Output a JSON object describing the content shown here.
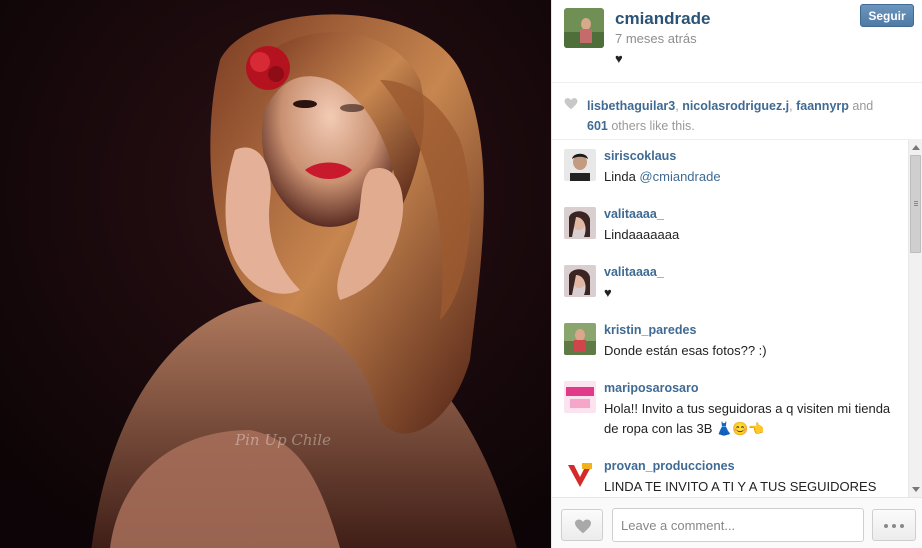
{
  "post": {
    "owner_username": "cmiandrade",
    "time_ago": "7 meses atrás",
    "caption": "♥",
    "follow_label": "Seguir",
    "photo_watermark": "Pin Up Chile"
  },
  "likes": {
    "users": [
      "lisbethaguilar3",
      "nicolasrodriguez.j",
      "faannyrp"
    ],
    "sep1": ", ",
    "sep2": ", ",
    "and_text": " and",
    "count": "601",
    "tail_text": " others like this."
  },
  "comments": [
    {
      "username": "siriscoklaus",
      "text": "Linda ",
      "mention": "@cmiandrade"
    },
    {
      "username": "valitaaaa_",
      "text": "Lindaaaaaaa"
    },
    {
      "username": "valitaaaa_",
      "text": "♥"
    },
    {
      "username": "kristin_paredes",
      "text": "Donde están esas fotos?? :)"
    },
    {
      "username": "mariposarosaro",
      "text": "Hola!! Invito a tus seguidoras a q visiten mi tienda de ropa con las 3B 👗😊👈"
    },
    {
      "username": "provan_producciones",
      "text": "LINDA TE INVITO A TI Y A TUS SEGUIDORES 😉👌A VER NUESTRA NUEVA COLECCIÓN ANIMAL PRINT!!💋💋💋NO,SE LO PIERDAN 💖💖👈"
    }
  ],
  "footer": {
    "comment_placeholder": "Leave a comment..."
  },
  "icons": {
    "like": "heart-icon",
    "more": "ellipsis-icon"
  },
  "colors": {
    "link": "#3f6a93",
    "follow_button": "#5a86b1"
  }
}
